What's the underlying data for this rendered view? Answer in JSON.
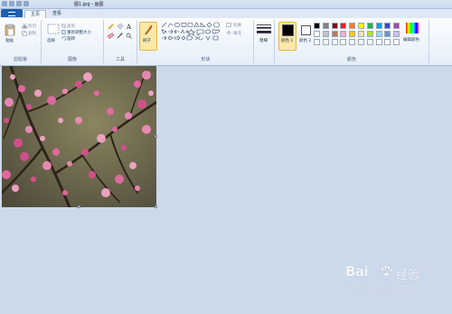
{
  "window": {
    "title": "图1.jpg - 画图"
  },
  "tabs": [
    {
      "label": "主页"
    },
    {
      "label": "查看"
    }
  ],
  "clipboard": {
    "paste": "粘贴",
    "cut": "剪切",
    "copy": "复制",
    "group": "剪贴板"
  },
  "image": {
    "select": "选择",
    "crop": "裁剪",
    "resize": "重新调整大小",
    "rotate": "旋转",
    "group": "图像"
  },
  "tools": {
    "group": "工具"
  },
  "brushes": {
    "label": "刷子"
  },
  "shapes": {
    "outline": "轮廓",
    "fill": "填充",
    "group": "形状"
  },
  "size": {
    "label": "粗细"
  },
  "colors": {
    "color1": "颜色 1",
    "color2": "颜色 2",
    "edit": "编辑颜色",
    "group": "颜色",
    "color1_value": "#000000",
    "color2_value": "#ffffff",
    "palette_row1": [
      "#000000",
      "#7f7f7f",
      "#880015",
      "#ed1c24",
      "#ff7f27",
      "#fff200",
      "#22b14c",
      "#00a2e8",
      "#3f48cc",
      "#a349a4"
    ],
    "palette_row2": [
      "#ffffff",
      "#c3c3c3",
      "#b97a57",
      "#ffaec9",
      "#ffc90e",
      "#efe4b0",
      "#b5e61d",
      "#99d9ea",
      "#7092be",
      "#c8bfe7"
    ]
  },
  "watermark": {
    "brand": "Bai",
    "brand2": "经验",
    "url": "jingyan.baidu.com"
  }
}
